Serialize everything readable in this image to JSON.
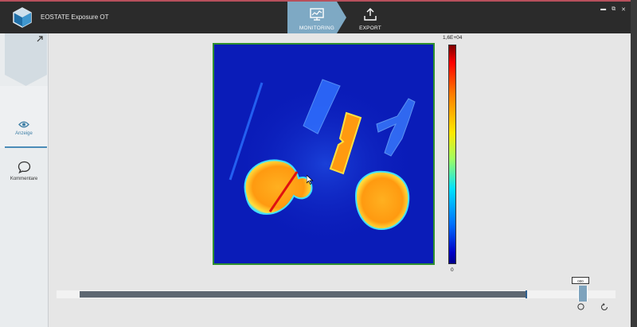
{
  "window": {
    "title": "EOSTATE Exposure OT",
    "controls": {
      "minimize": "▬",
      "restore": "⧉",
      "close": "✕"
    }
  },
  "tabs": [
    {
      "label": "MONITORING",
      "icon": "monitor-chart-icon",
      "active": true
    },
    {
      "label": "EXPORT",
      "icon": "upload-icon",
      "active": false
    }
  ],
  "sidebar": {
    "items": [
      {
        "label": "Anzeige",
        "icon": "eye-icon",
        "active": true
      },
      {
        "label": "Kommentare",
        "icon": "speech-bubble-icon",
        "active": false
      }
    ]
  },
  "colorbar": {
    "max_label": "1,6E+04",
    "min_label": "0"
  },
  "timeline": {
    "slider_label": "000",
    "progress": 0.84
  },
  "colors": {
    "titlebar": "#2b2b2b",
    "accent": "#4a8cb8",
    "active_tab": "#7ea9c4",
    "heatmap_background": "#0a18b8"
  }
}
